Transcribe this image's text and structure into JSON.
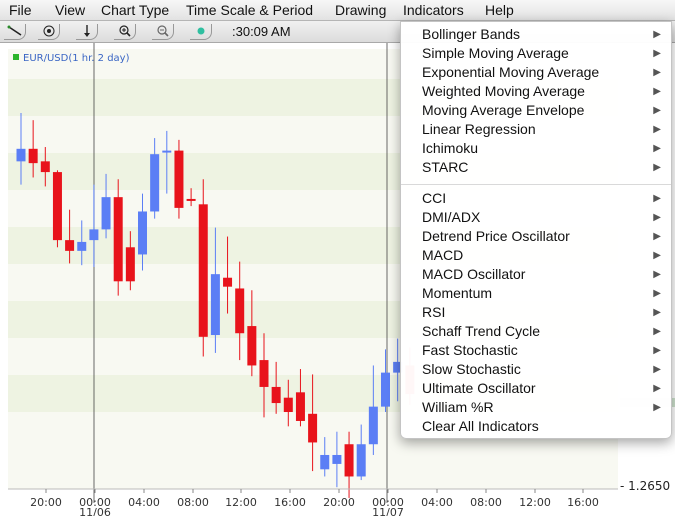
{
  "menubar": {
    "items": [
      "File",
      "View",
      "Chart Type",
      "Time Scale & Period",
      "Drawing",
      "Indicators",
      "Help"
    ]
  },
  "toolbar": {
    "time_readout": ":30:09 AM",
    "icons": [
      "line-tool-icon",
      "target-icon",
      "arrow-down-icon",
      "zoom-in-icon",
      "zoom-out-icon",
      "dot-icon"
    ]
  },
  "chart": {
    "symbol_label": "EUR/USD(1 hr. 2 day)",
    "price_label": "- 1.2650",
    "colors": {
      "up": "#5b7ef5",
      "down": "#e8131b",
      "band": "#eef3e2",
      "bg": "#f8f9f2"
    }
  },
  "indicators_menu": {
    "group1": [
      "Bollinger Bands",
      "Simple Moving Average",
      "Exponential Moving Average",
      "Weighted Moving Average",
      "Moving Average Envelope",
      "Linear Regression",
      "Ichimoku",
      "STARC"
    ],
    "group2": [
      "CCI",
      "DMI/ADX",
      "Detrend Price Oscillator",
      "MACD",
      "MACD Oscillator",
      "Momentum",
      "RSI",
      "Schaff Trend Cycle",
      "Fast Stochastic",
      "Slow Stochastic",
      "Ultimate Oscillator",
      "William %R"
    ],
    "clear_label": "Clear All Indicators"
  },
  "chart_data": {
    "type": "candlestick",
    "xlabel": "",
    "ylabel": "",
    "x_tick_labels": [
      "20:00",
      "00:00",
      "04:00",
      "08:00",
      "12:00",
      "16:00",
      "20:00",
      "00:00",
      "04:00",
      "08:00",
      "12:00",
      "16:00"
    ],
    "date_labels": [
      "11/06",
      "11/07"
    ],
    "y_tick_labels": [
      "1.2650"
    ],
    "candles": [
      {
        "dir": "up",
        "open": 1.2833,
        "close": 1.284,
        "high": 1.286,
        "low": 1.282
      },
      {
        "dir": "down",
        "open": 1.284,
        "close": 1.2832,
        "high": 1.2856,
        "low": 1.2824
      },
      {
        "dir": "down",
        "open": 1.2833,
        "close": 1.2827,
        "high": 1.2841,
        "low": 1.2819
      },
      {
        "dir": "down",
        "open": 1.2827,
        "close": 1.2789,
        "high": 1.2828,
        "low": 1.2785
      },
      {
        "dir": "down",
        "open": 1.2789,
        "close": 1.2783,
        "high": 1.2806,
        "low": 1.2776
      },
      {
        "dir": "up",
        "open": 1.2783,
        "close": 1.2788,
        "high": 1.28,
        "low": 1.2775
      },
      {
        "dir": "up",
        "open": 1.2789,
        "close": 1.2795,
        "high": 1.282,
        "low": 1.2774
      },
      {
        "dir": "up",
        "open": 1.2795,
        "close": 1.2813,
        "high": 1.2826,
        "low": 1.279
      },
      {
        "dir": "down",
        "open": 1.2813,
        "close": 1.2766,
        "high": 1.2823,
        "low": 1.2758
      },
      {
        "dir": "down",
        "open": 1.2766,
        "close": 1.2785,
        "high": 1.2794,
        "low": 1.2761
      },
      {
        "dir": "up",
        "open": 1.2781,
        "close": 1.2805,
        "high": 1.2815,
        "low": 1.2772
      },
      {
        "dir": "up",
        "open": 1.2805,
        "close": 1.2837,
        "high": 1.2846,
        "low": 1.2801
      },
      {
        "dir": "up",
        "open": 1.2838,
        "close": 1.2839,
        "high": 1.285,
        "low": 1.2815
      },
      {
        "dir": "down",
        "open": 1.2839,
        "close": 1.2807,
        "high": 1.2845,
        "low": 1.2801
      },
      {
        "dir": "down",
        "open": 1.2811,
        "close": 1.2812,
        "high": 1.2818,
        "low": 1.2808
      },
      {
        "dir": "down",
        "open": 1.2809,
        "close": 1.2735,
        "high": 1.2823,
        "low": 1.2724
      },
      {
        "dir": "up",
        "open": 1.2736,
        "close": 1.277,
        "high": 1.2796,
        "low": 1.2726
      },
      {
        "dir": "down",
        "open": 1.2768,
        "close": 1.2763,
        "high": 1.2791,
        "low": 1.2748
      },
      {
        "dir": "down",
        "open": 1.2762,
        "close": 1.2737,
        "high": 1.2777,
        "low": 1.2722
      },
      {
        "dir": "down",
        "open": 1.2741,
        "close": 1.2719,
        "high": 1.2761,
        "low": 1.2713
      },
      {
        "dir": "down",
        "open": 1.2722,
        "close": 1.2707,
        "high": 1.2737,
        "low": 1.269
      },
      {
        "dir": "down",
        "open": 1.2707,
        "close": 1.2698,
        "high": 1.2721,
        "low": 1.2692
      },
      {
        "dir": "down",
        "open": 1.2701,
        "close": 1.2693,
        "high": 1.2711,
        "low": 1.2685
      },
      {
        "dir": "down",
        "open": 1.2704,
        "close": 1.2688,
        "high": 1.2717,
        "low": 1.2685
      },
      {
        "dir": "down",
        "open": 1.2692,
        "close": 1.2676,
        "high": 1.2714,
        "low": 1.266
      },
      {
        "dir": "up",
        "open": 1.2661,
        "close": 1.2669,
        "high": 1.2679,
        "low": 1.2657
      },
      {
        "dir": "up",
        "open": 1.2664,
        "close": 1.2669,
        "high": 1.2682,
        "low": 1.2651
      },
      {
        "dir": "down",
        "open": 1.2675,
        "close": 1.2657,
        "high": 1.2682,
        "low": 1.2645
      },
      {
        "dir": "up",
        "open": 1.2657,
        "close": 1.2675,
        "high": 1.2686,
        "low": 1.2655
      },
      {
        "dir": "up",
        "open": 1.2675,
        "close": 1.2696,
        "high": 1.2719,
        "low": 1.2669
      },
      {
        "dir": "up",
        "open": 1.2696,
        "close": 1.2715,
        "high": 1.2728,
        "low": 1.2693
      },
      {
        "dir": "up",
        "open": 1.2715,
        "close": 1.2721,
        "high": 1.2734,
        "low": 1.2699
      },
      {
        "dir": "down",
        "open": 1.2719,
        "close": 1.2703,
        "high": 1.2729,
        "low": 1.2697
      }
    ]
  }
}
